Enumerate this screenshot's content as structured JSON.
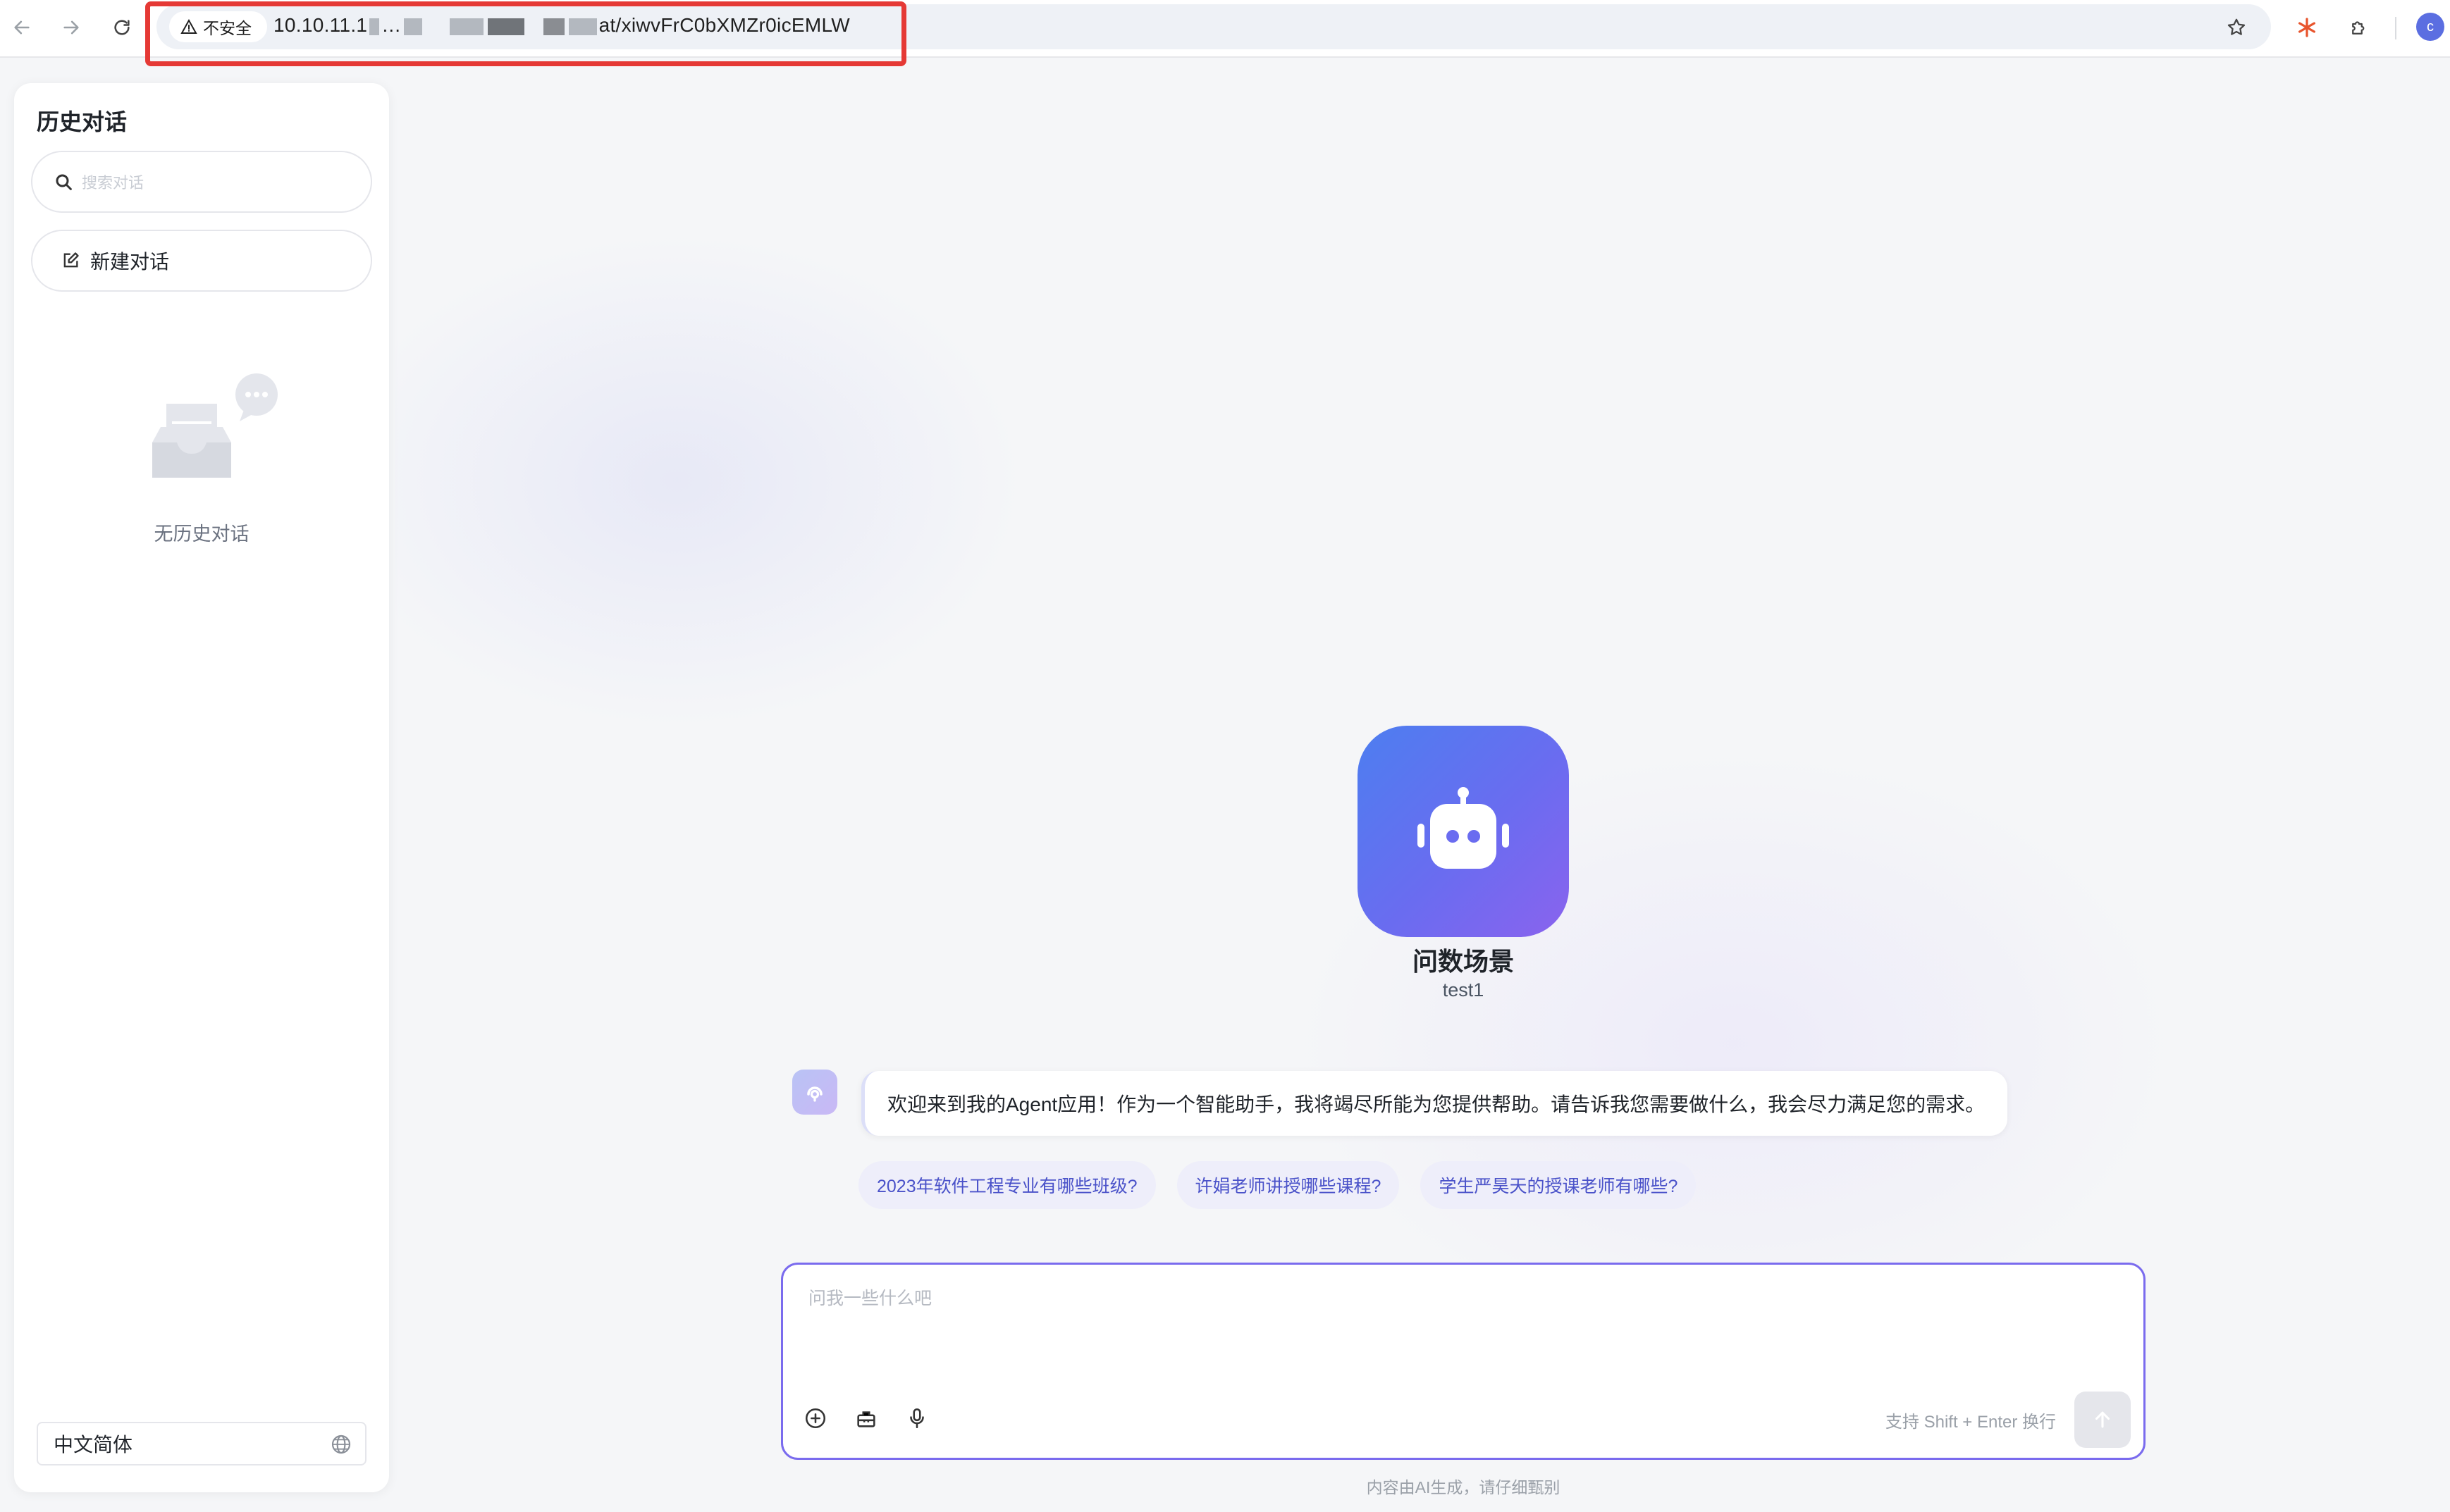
{
  "browser": {
    "security_label": "不安全",
    "url_prefix": "10.10.11.1",
    "url_mid": "…",
    "url_suffix": "at/xiwvFrC0bXMZr0icEMLW",
    "profile_initial": "c",
    "highlight_color": "#e53935"
  },
  "sidebar": {
    "title": "历史对话",
    "search_placeholder": "搜索对话",
    "new_chat_label": "新建对话",
    "empty_text": "无历史对话",
    "language_value": "中文简体"
  },
  "app": {
    "name": "问数场景",
    "subtitle": "test1",
    "accent_color": "#6a6cf0"
  },
  "chat": {
    "welcome_message": "欢迎来到我的Agent应用！作为一个智能助手，我将竭尽所能为您提供帮助。请告诉我您需要做什么，我会尽力满足您的需求。",
    "suggestions": [
      "2023年软件工程专业有哪些班级?",
      "许娟老师讲授哪些课程?",
      "学生严昊天的授课老师有哪些?"
    ]
  },
  "composer": {
    "placeholder": "问我一些什么吧",
    "hint": "支持 Shift + Enter 换行",
    "icons": [
      "plus-circle-icon",
      "toolbox-icon",
      "microphone-icon",
      "arrow-up-icon"
    ]
  },
  "footer": {
    "disclaimer": "内容由AI生成，请仔细甄别"
  }
}
